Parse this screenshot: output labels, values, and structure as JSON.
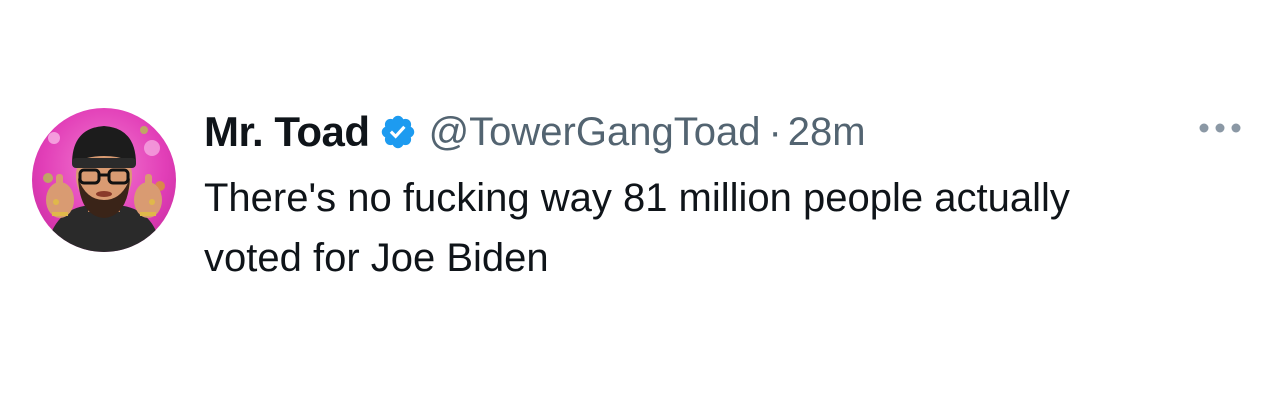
{
  "tweet": {
    "display_name": "Mr. Toad",
    "handle": "@TowerGangToad",
    "separator": "·",
    "timestamp": "28m",
    "text": "There's no fucking way 81 million people actually voted for Joe Biden",
    "verified": true
  },
  "icons": {
    "verified": "verified-check-icon",
    "more": "more-options-icon"
  },
  "colors": {
    "verified_blue": "#1d9bf0",
    "text_primary": "#0f1419",
    "text_secondary": "#536471",
    "avatar_background": "#e23fb8"
  }
}
